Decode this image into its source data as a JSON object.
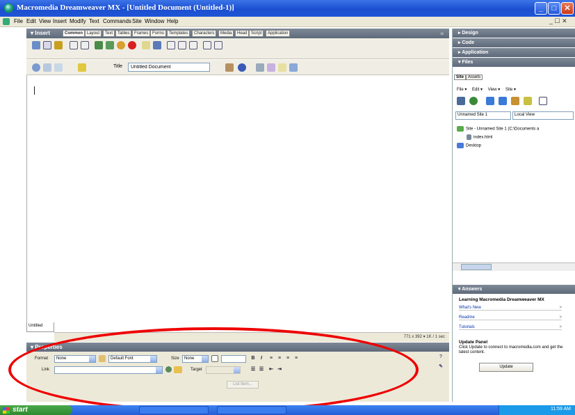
{
  "window": {
    "title": "Macromedia Dreamweaver MX - [Untitled Document (Untitled-1)]",
    "min": "_",
    "max": "□",
    "close": "✕"
  },
  "menubar": {
    "items": [
      "File",
      "Edit",
      "View",
      "Insert",
      "Modify",
      "Text",
      "Commands",
      "Site",
      "Window",
      "Help"
    ],
    "mdi_controls": "_ ☐ ✕"
  },
  "insert_panel": {
    "title": "▾ Insert",
    "tabs": [
      "Common",
      "Layout",
      "Text",
      "Tables",
      "Frames",
      "Forms",
      "Templates",
      "Characters",
      "Media",
      "Head",
      "Script",
      "Application"
    ],
    "active_tab": "Common"
  },
  "document_toolbar": {
    "title_label": "Title",
    "title_value": "Untitled Document"
  },
  "document": {
    "tab_label": "Untitled",
    "status": "771 x 392 ▾ 1K / 1 sec"
  },
  "properties": {
    "header": "▾ Properties",
    "format_label": "Format",
    "format_value": "None",
    "font_value": "Default Font",
    "size_label": "Size",
    "size_value": "None",
    "link_label": "Link",
    "target_label": "Target",
    "list_item_button": "List Item..."
  },
  "right_panels": {
    "design": "▸ Design",
    "code": "▸ Code",
    "application": "▸ Application",
    "files": "▾ Files",
    "files_tabs": [
      "Site",
      "Assets"
    ],
    "files_menu": [
      "File ▾",
      "Edit ▾",
      "View ▾",
      "Site ▾"
    ],
    "site_select": "Unnamed Site 1",
    "view_select": "Local View",
    "tree": [
      "Site - Unnamed Site 1 (C:\\Documents a",
      "index.html",
      "Desktop"
    ],
    "answers": "▾ Answers",
    "learning_title": "Learning Macromedia Dreamweaver MX",
    "links": [
      "What's New",
      "Readme",
      "Tutorials"
    ],
    "update_title": "Update Panel",
    "update_text": "Click Update to connect to macromedia.com and get the latest content.",
    "update_button": "Update"
  },
  "taskbar": {
    "start": "start",
    "clock": "11:59 AM"
  }
}
